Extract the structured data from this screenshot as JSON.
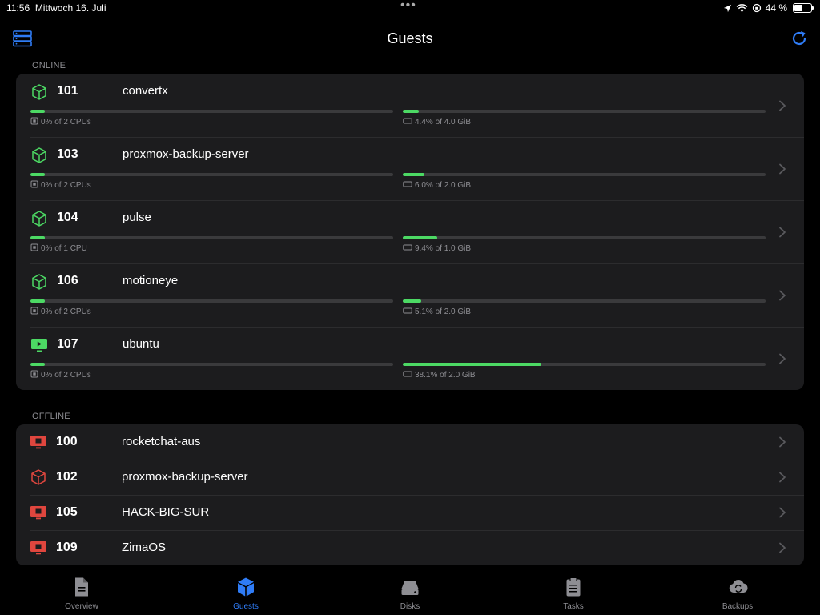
{
  "status_bar": {
    "time": "11:56",
    "date": "Mittwoch 16. Juli",
    "battery": "44 %",
    "battery_level": 0.44
  },
  "nav": {
    "title": "Guests",
    "left_icon": "server-list-icon",
    "right_icon": "refresh-icon"
  },
  "colors": {
    "accent": "#2f7cf6",
    "online": "#4cd964",
    "offline": "#e0463e"
  },
  "online_section": {
    "header": "ONLINE",
    "guests": [
      {
        "id": "101",
        "name": "convertx",
        "type": "container",
        "cpu_label": "0% of 2 CPUs",
        "cpu_fraction": 0.0,
        "mem_label": "4.4% of 4.0 GiB",
        "mem_fraction": 0.044
      },
      {
        "id": "103",
        "name": "proxmox-backup-server",
        "type": "container",
        "cpu_label": "0% of 2 CPUs",
        "cpu_fraction": 0.0,
        "mem_label": "6.0% of 2.0 GiB",
        "mem_fraction": 0.06
      },
      {
        "id": "104",
        "name": "pulse",
        "type": "container",
        "cpu_label": "0% of 1 CPU",
        "cpu_fraction": 0.0,
        "mem_label": "9.4% of 1.0 GiB",
        "mem_fraction": 0.094
      },
      {
        "id": "106",
        "name": "motioneye",
        "type": "container",
        "cpu_label": "0% of 2 CPUs",
        "cpu_fraction": 0.0,
        "mem_label": "5.1% of 2.0 GiB",
        "mem_fraction": 0.051
      },
      {
        "id": "107",
        "name": "ubuntu",
        "type": "vm",
        "cpu_label": "0% of 2 CPUs",
        "cpu_fraction": 0.0,
        "mem_label": "38.1% of 2.0 GiB",
        "mem_fraction": 0.381
      }
    ]
  },
  "offline_section": {
    "header": "OFFLINE",
    "guests": [
      {
        "id": "100",
        "name": "rocketchat-aus",
        "type": "vm"
      },
      {
        "id": "102",
        "name": "proxmox-backup-server",
        "type": "container"
      },
      {
        "id": "105",
        "name": "HACK-BIG-SUR",
        "type": "vm"
      },
      {
        "id": "109",
        "name": "ZimaOS",
        "type": "vm"
      }
    ]
  },
  "tabs": [
    {
      "label": "Overview",
      "icon": "document-icon",
      "active": false
    },
    {
      "label": "Guests",
      "icon": "cube-icon",
      "active": true
    },
    {
      "label": "Disks",
      "icon": "disk-icon",
      "active": false
    },
    {
      "label": "Tasks",
      "icon": "clipboard-icon",
      "active": false
    },
    {
      "label": "Backups",
      "icon": "cloud-sync-icon",
      "active": false
    }
  ]
}
